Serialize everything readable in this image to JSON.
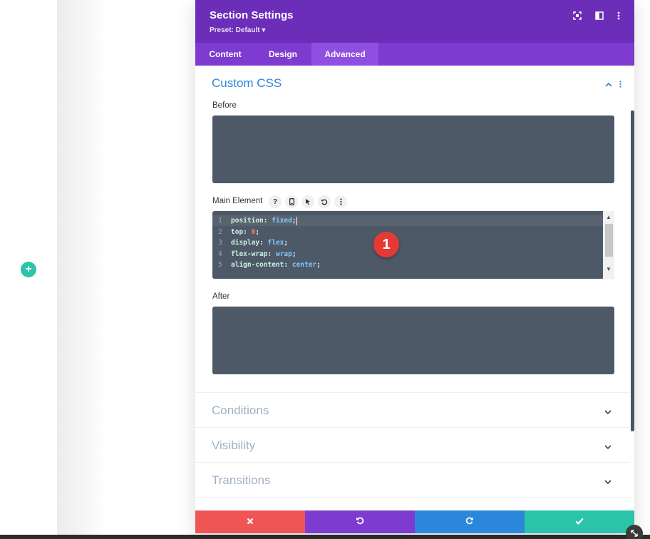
{
  "modal": {
    "title": "Section Settings",
    "preset": "Preset: Default ▾"
  },
  "tabs": [
    {
      "label": "Content",
      "active": false
    },
    {
      "label": "Design",
      "active": false
    },
    {
      "label": "Advanced",
      "active": true
    }
  ],
  "custom_css": {
    "title": "Custom CSS",
    "before_label": "Before",
    "main_label": "Main Element",
    "after_label": "After",
    "main_code": [
      {
        "n": "1",
        "prop": "position",
        "value": "fixed"
      },
      {
        "n": "2",
        "prop": "top",
        "value": "0"
      },
      {
        "n": "3",
        "prop": "display",
        "value": "flex"
      },
      {
        "n": "4",
        "prop": "flex-wrap",
        "value": "wrap"
      },
      {
        "n": "5",
        "prop": "align-content",
        "value": "center"
      }
    ],
    "main_label_icons": [
      "help-icon",
      "mobile-icon",
      "cursor-icon",
      "undo-icon",
      "more-icon"
    ]
  },
  "annotation_badge": "1",
  "accordions": [
    {
      "title": "Conditions"
    },
    {
      "title": "Visibility"
    },
    {
      "title": "Transitions"
    }
  ],
  "footer": {
    "buttons": [
      {
        "name": "cancel",
        "icon": "close-icon",
        "color": "#ef5555"
      },
      {
        "name": "undo",
        "icon": "undo-icon",
        "color": "#7d3bcf"
      },
      {
        "name": "redo",
        "icon": "redo-icon",
        "color": "#2b87da"
      },
      {
        "name": "save",
        "icon": "check-icon",
        "color": "#29c4a9"
      }
    ]
  },
  "colors": {
    "header": "#6c2eb9",
    "tabs": "#7d3bcf",
    "accent_blue": "#2b87da",
    "code_bg": "#4e5968"
  }
}
